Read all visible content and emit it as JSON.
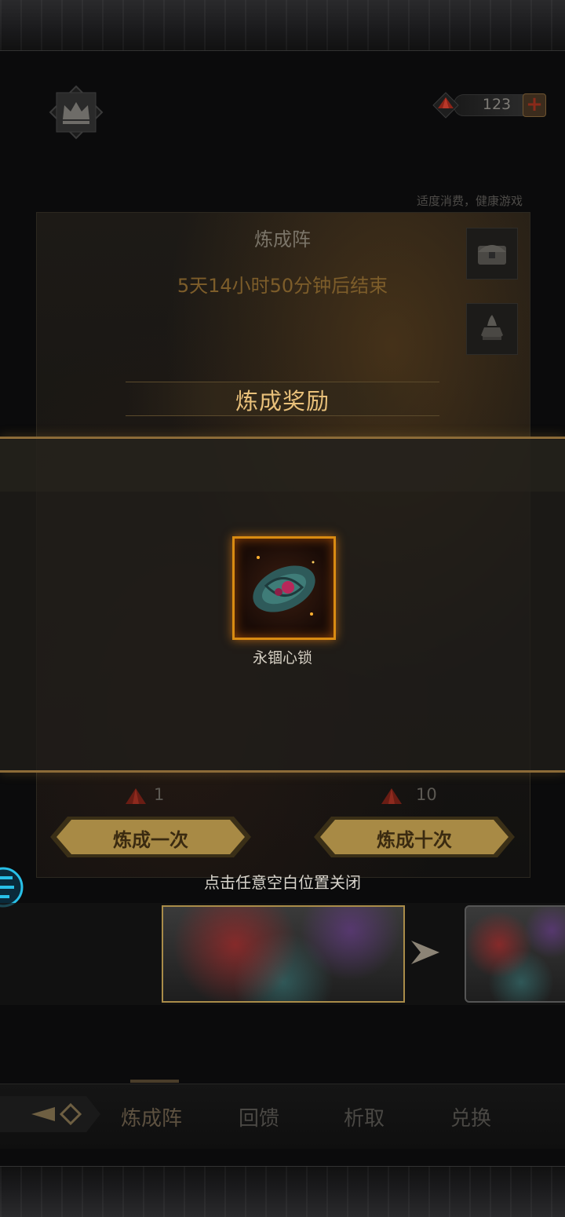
{
  "header": {
    "currency": {
      "count": "123",
      "plus_label": "+"
    },
    "notice": "适度消费，健康游戏"
  },
  "panel": {
    "title": "炼成阵",
    "timer": "5天14小时50分钟后结束"
  },
  "reward_modal": {
    "title": "炼成奖励",
    "item": {
      "name": "永锢心锁"
    },
    "close_hint": "点击任意空白位置关闭"
  },
  "actions": {
    "single": {
      "cost": "1",
      "label": "炼成一次"
    },
    "ten": {
      "cost": "10",
      "label": "炼成十次"
    }
  },
  "nav": {
    "tabs": [
      {
        "label": "炼成阵",
        "active": true
      },
      {
        "label": "回馈",
        "active": false
      },
      {
        "label": "析取",
        "active": false
      },
      {
        "label": "兑换",
        "active": false
      }
    ]
  },
  "colors": {
    "accent_gold": "#e8c07a",
    "item_border": "#d98b12",
    "button_gold": "#a88a45"
  }
}
